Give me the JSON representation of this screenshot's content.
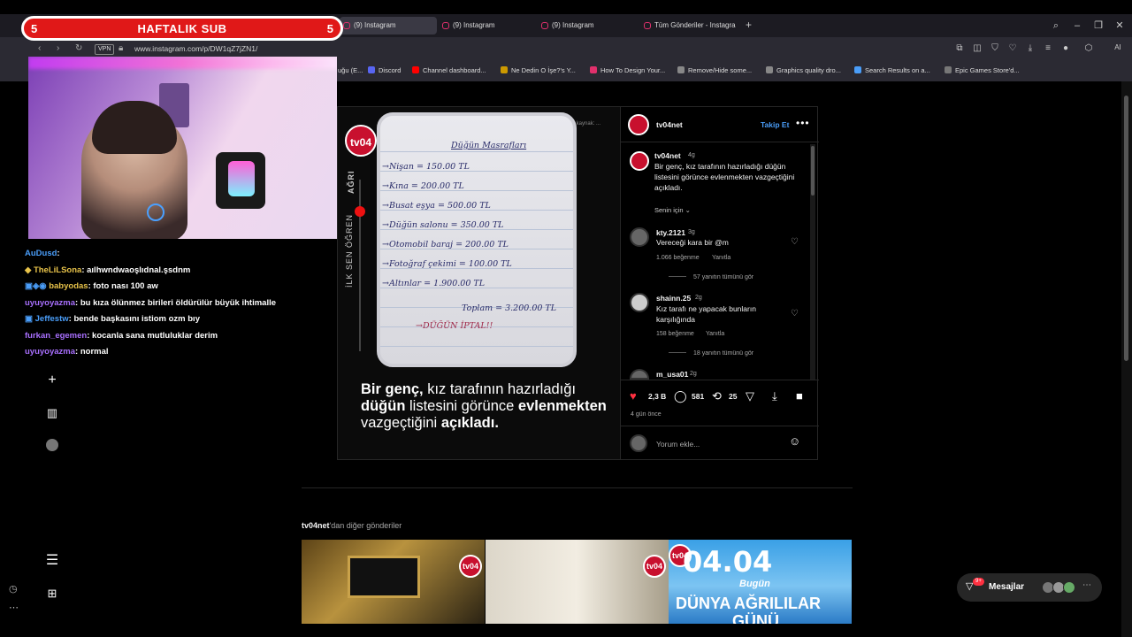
{
  "browser": {
    "tabs": [
      {
        "label": "(9) Instagram",
        "active": true
      },
      {
        "label": "(9) Instagram",
        "active": false
      },
      {
        "label": "(9) Instagram",
        "active": false
      },
      {
        "label": "Tüm Gönderiler - Instagra",
        "active": false
      }
    ],
    "new_tab": "+",
    "vpn": "VPN",
    "url": "www.instagram.com/p/DW1qZ7jZN1/",
    "ai_label": "AI",
    "bookmarks": [
      "uğu (E...",
      "Discord",
      "Channel dashboard...",
      "Ne Dedin O İşe?'s Y...",
      "How To Design Your...",
      "Remove/Hide some...",
      "Graphics quality dro...",
      "Search Results on a...",
      "Epic Games Store'd..."
    ]
  },
  "stream": {
    "banner": {
      "title": "HAFTALIK SUB",
      "left_num": "5",
      "right_num": "5"
    },
    "chat": [
      {
        "user": "AuDusd",
        "msg": ":",
        "user_color": "#4a9df8"
      },
      {
        "user": "TheLiLSona",
        "msg": ": aılhwndwaoşlıdnal.şsdnm",
        "user_color": "#e8c34a"
      },
      {
        "user": "babyodas",
        "msg": ": foto nası 100 aw",
        "user_color": "#e8c34a"
      },
      {
        "user": "uyuyoyazma",
        "msg": ": bu kıza ölünmez birileri öldürülür büyük ihtimalle",
        "user_color": "#a970ff"
      },
      {
        "user": "Jeffestw",
        "msg": ": bende başkasını istiom ozm bıy",
        "user_color": "#4a9df8"
      },
      {
        "user": "furkan_egemen",
        "msg": ": kocanla sana mutluluklar derim",
        "user_color": "#a970ff"
      },
      {
        "user": "uyuyoyazma",
        "msg": ": normal",
        "user_color": "#a970ff"
      }
    ]
  },
  "post": {
    "media": {
      "logo": "tv04",
      "side_labels": [
        "AĞRI",
        "İLK SEN ÖĞREN"
      ],
      "watermark": "Temsili fotoğraf, kaynak: ...",
      "list_title": "Düğün Masrafları",
      "list_items": [
        "→Nişan = 150.00 TL",
        "→Kına = 200.00 TL",
        "→Busat eşya = 500.00 TL",
        "→Düğün salonu = 350.00 TL",
        "→Otomobil baraj = 200.00 TL",
        "→Fotoğraf çekimi = 100.00 TL",
        "→Altınlar = 1.900.00 TL"
      ],
      "total": "Toplam = 3.200.00 TL",
      "cancel": "→DÜĞÜN İPTAL!!",
      "caption": [
        {
          "t": "Bir genç,",
          "b": true
        },
        {
          "t": " kız tarafının hazırladığı ",
          "b": false
        },
        {
          "t": "düğün",
          "b": true
        },
        {
          "t": " listesini görünce ",
          "b": false
        },
        {
          "t": "evlenmekten",
          "b": true
        },
        {
          "t": " vazgeçtiğini ",
          "b": false
        },
        {
          "t": "açıkladı.",
          "b": true
        }
      ]
    },
    "account": "tv04net",
    "follow": "Takip Et",
    "more": "•••",
    "description": {
      "user": "tv04net",
      "age": "4g",
      "text": "Bir genç, kız tarafının hazırladığı düğün listesini görünce evlenmekten vazgeçtiğini açıkladı.",
      "translation": "Senin için"
    },
    "comments": [
      {
        "user": "kty.2121",
        "age": "3g",
        "text": "Vereceği kara bir @m",
        "likes": "1.066 beğenme",
        "reply": "Yanıtla",
        "view_replies": "57 yanıtın tümünü gör"
      },
      {
        "user": "shainn.25",
        "age": "2g",
        "text": "Kız tarafı ne yapacak bunların karşılığında",
        "likes": "158 beğenme",
        "reply": "Yanıtla",
        "view_replies": "18 yanıtın tümünü gör"
      },
      {
        "user": "m_usa01",
        "age": "2g",
        "text": "",
        "likes": "",
        "reply": "",
        "view_replies": ""
      }
    ],
    "actions": {
      "likes": "2,3 B",
      "comments": "581",
      "reposts": "25"
    },
    "posted": "4 gün önce",
    "comment_placeholder": "Yorum ekle..."
  },
  "more_posts": {
    "account": "tv04net",
    "suffix": "'dan diğer gönderiler"
  },
  "thumbs": [
    {
      "label": "tv04"
    },
    {
      "label": "tv04"
    },
    {
      "label": "tv04",
      "big": "04.04",
      "mid": "Bugün",
      "bottom": "DÜNYA AĞRILILAR",
      "tail": "GÜNÜ"
    }
  ],
  "messages": {
    "label": "Mesajlar",
    "badge": "9+"
  },
  "colors": {
    "brand": "#c8102e",
    "follow": "#4a9df8",
    "like": "#ff3040",
    "banner": "#e01818"
  }
}
